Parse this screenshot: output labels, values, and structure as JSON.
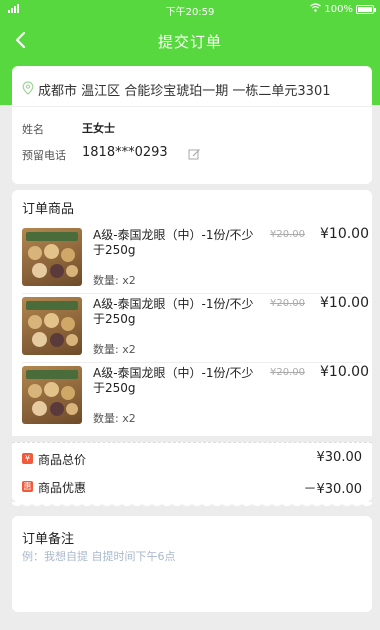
{
  "status": {
    "time": "下午20:59",
    "battery": "100%"
  },
  "nav": {
    "title": "提交订单"
  },
  "address": {
    "text": "成都市 温江区 合能珍宝琥珀一期   一栋二单元3301"
  },
  "contact": {
    "name_label": "姓名",
    "name_value": "王女士",
    "phone_label": "预留电话",
    "phone_value": "1818***0293"
  },
  "goods": {
    "title": "订单商品",
    "items": [
      {
        "name": "A级-泰国龙眼（中）-1份/不少于250g",
        "original_price": "¥20.00",
        "price": "¥10.00",
        "quantity": "数量:  x2",
        "image_label": "泰国龙眼"
      },
      {
        "name": "A级-泰国龙眼（中）-1份/不少于250g",
        "original_price": "¥20.00",
        "price": "¥10.00",
        "quantity": "数量:  x2",
        "image_label": "泰国龙眼"
      },
      {
        "name": "A级-泰国龙眼（中）-1份/不少于250g",
        "original_price": "¥20.00",
        "price": "¥10.00",
        "quantity": "数量:  x2",
        "image_label": "泰国龙眼"
      }
    ]
  },
  "summary": {
    "total_badge": "¥",
    "total_label": "商品总价",
    "total_value": "¥30.00",
    "discount_badge": "惠",
    "discount_label": "商品优惠",
    "discount_value": "－¥30.00"
  },
  "remark": {
    "title": "订单备注",
    "placeholder": "例：我想自提 自提时间下午6点"
  },
  "colors": {
    "accent": "#58d83f",
    "badge": "#f25a3c",
    "placeholder": "#a9b8cc"
  }
}
